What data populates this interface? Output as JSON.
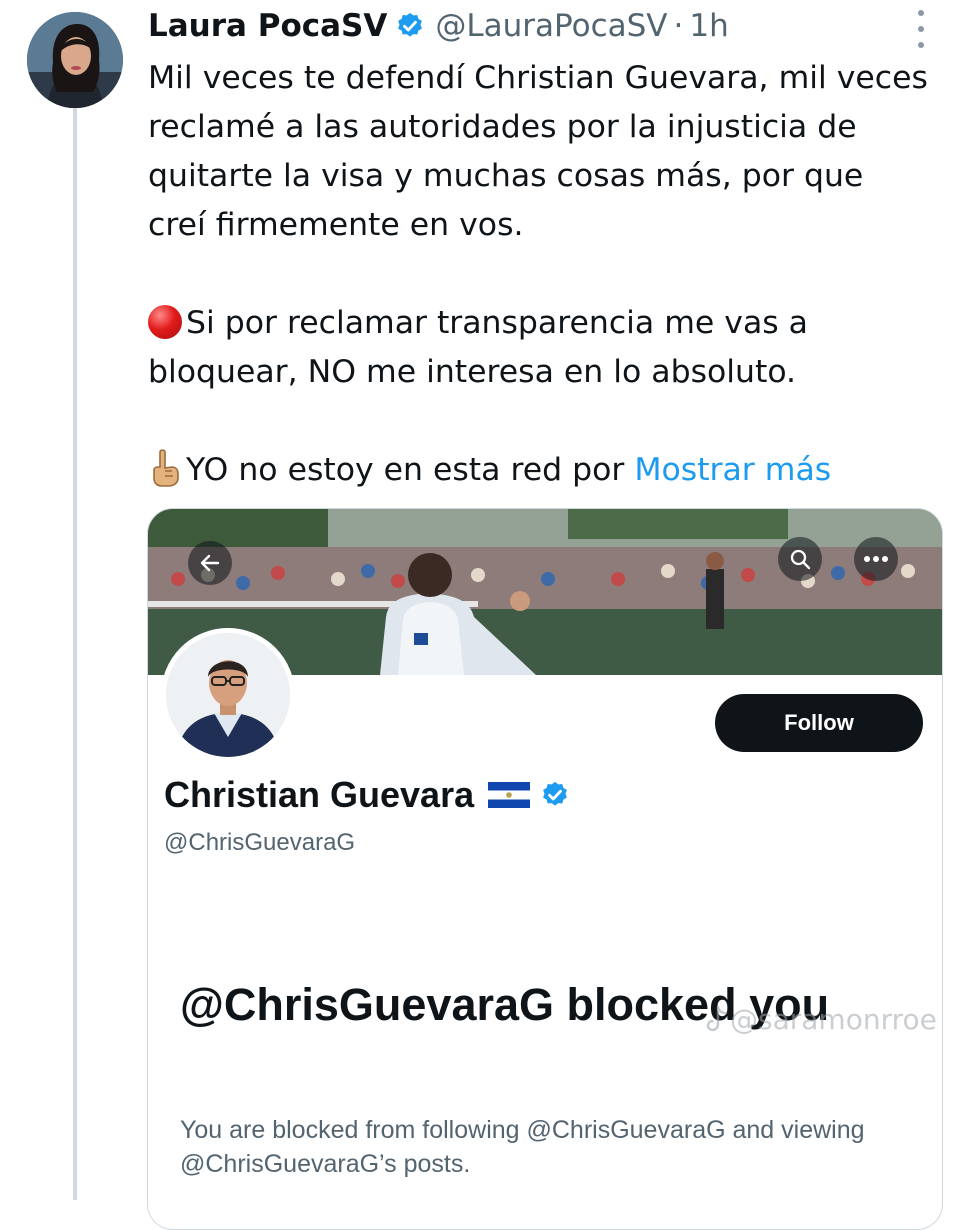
{
  "tweet": {
    "author_name": "Laura PocaSV",
    "author_handle": "@LauraPocaSV",
    "separator": "·",
    "time": "1h",
    "paragraph_1": "Mil veces te defendí Christian Guevara, mil veces reclamé a las autoridades por la injusticia de quitarte la visa y muchas cosas más, por que creí firmemente en vos.",
    "paragraph_2": "Si por reclamar transparencia me vas a bloquear, NO me interesa en lo absoluto.",
    "paragraph_3": "YO no estoy en esta red por",
    "show_more": "Mostrar más"
  },
  "embedded_screenshot": {
    "follow_button": "Follow",
    "profile_name": "Christian Guevara",
    "profile_handle": "@ChrisGuevaraG",
    "blocked_title": "@ChrisGuevaraG blocked you",
    "blocked_description": "You are blocked from following @ChrisGuevaraG and viewing @ChrisGuevaraG’s posts."
  },
  "watermark": "@saramonrroe",
  "colors": {
    "link": "#1d9bf0",
    "verified": "#1d9bf0",
    "text_primary": "#0f1419",
    "text_secondary": "#536471",
    "button_dark": "#0f1419"
  },
  "icons": [
    "verified-badge-icon",
    "more-dots-icon",
    "red-circle-emoji",
    "index-pointing-up-emoji",
    "back-arrow-icon",
    "search-icon",
    "more-horizontal-icon",
    "el-salvador-flag-icon",
    "tiktok-icon"
  ]
}
